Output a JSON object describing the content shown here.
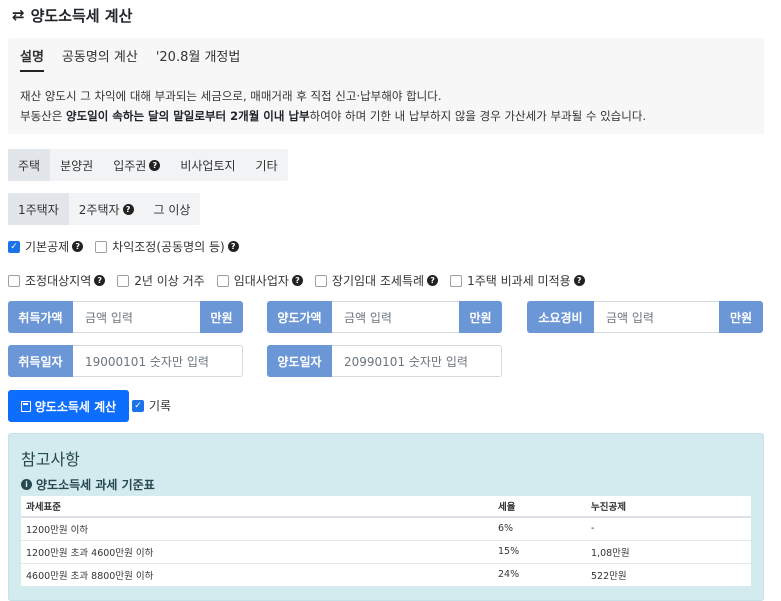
{
  "page": {
    "title": "양도소득세 계산",
    "title_icon": "swap-arrows-icon"
  },
  "info": {
    "tabs": [
      "설명",
      "공동명의 계산",
      "'20.8월 개정법"
    ],
    "line1": "재산 양도시 그 차익에 대해 부과되는 세금으로, 매매거래 후 직접 신고·납부해야 합니다.",
    "line2_a": "부동산은 ",
    "line2_b": "양도일이 속하는 달의 말일로부터 2개월 이내 납부",
    "line2_c": "하여야 하며 기한 내 납부하지 않을 경우 가산세가 부과될 수 있습니다."
  },
  "property_tabs": [
    "주택",
    "분양권",
    "입주권",
    "비사업토지",
    "기타"
  ],
  "house_count_tabs": [
    "1주택자",
    "2주택자",
    "그 이상"
  ],
  "options_row1": [
    {
      "label": "기본공제",
      "checked": true
    },
    {
      "label": "차익조정(공동명의 등)",
      "checked": false
    }
  ],
  "options_row2": [
    {
      "label": "조정대상지역",
      "checked": false
    },
    {
      "label": "2년 이상 거주",
      "checked": false
    },
    {
      "label": "임대사업자",
      "checked": false
    },
    {
      "label": "장기임대 조세특례",
      "checked": false
    },
    {
      "label": "1주택 비과세 미적용",
      "checked": false
    }
  ],
  "fields": {
    "acquire_price": {
      "label": "취득가액",
      "placeholder": "금액 입력",
      "unit": "만원"
    },
    "transfer_price": {
      "label": "양도가액",
      "placeholder": "금액 입력",
      "unit": "만원"
    },
    "expense": {
      "label": "소요경비",
      "placeholder": "금액 입력",
      "unit": "만원"
    },
    "acquire_date": {
      "label": "취득일자",
      "placeholder": "19000101 숫자만 입력"
    },
    "transfer_date": {
      "label": "양도일자",
      "placeholder": "20990101 숫자만 입력"
    }
  },
  "calc_button": "양도소득세 계산",
  "record": {
    "label": "기록",
    "checked": true
  },
  "reference": {
    "title": "참고사항",
    "subtitle": "양도소득세 과세 기준표",
    "headers": [
      "과세표준",
      "세율",
      "누진공제"
    ],
    "rows": [
      [
        "1200만원 이하",
        "6%",
        "-"
      ],
      [
        "1200만원 초과 4600만원 이하",
        "15%",
        "1,08만원"
      ],
      [
        "4600만원 초과 8800만원 이하",
        "24%",
        "522만원"
      ]
    ]
  },
  "colors": {
    "primary": "#0d6efd",
    "label_blue": "#6c97d6",
    "ref_bg": "#d3ebef"
  }
}
